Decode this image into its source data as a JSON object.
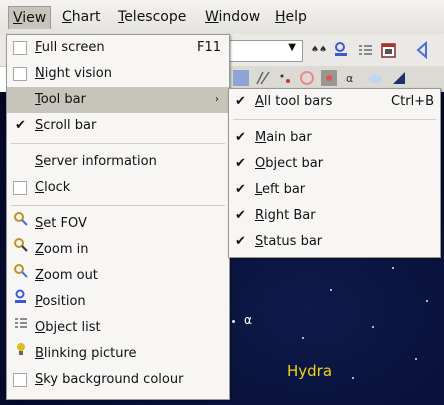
{
  "menubar": {
    "items": [
      {
        "label": "View",
        "u": "V",
        "rest": "iew"
      },
      {
        "label": "Chart",
        "u": "C",
        "rest": "hart"
      },
      {
        "label": "Telescope",
        "u": "T",
        "rest": "elescope"
      },
      {
        "label": "Window",
        "u": "W",
        "rest": "indow"
      },
      {
        "label": "Help",
        "u": "H",
        "rest": "elp"
      }
    ]
  },
  "view_menu": {
    "items": [
      {
        "pre": "",
        "u": "F",
        "rest": "ull screen",
        "shortcut": "F11"
      },
      {
        "pre": "",
        "u": "N",
        "rest": "ight vision"
      },
      {
        "pre": "",
        "u": "T",
        "rest": "ool bar",
        "arrow": "›"
      },
      {
        "pre": "",
        "u": "S",
        "rest": "croll bar"
      },
      {
        "pre": "",
        "u": "S",
        "rest": "erver information"
      },
      {
        "pre": "",
        "u": "C",
        "rest": "lock"
      },
      {
        "pre": "",
        "u": "S",
        "rest": "et FOV"
      },
      {
        "pre": "",
        "u": "Z",
        "rest": "oom in"
      },
      {
        "pre": "",
        "u": "Z",
        "rest": "oom out"
      },
      {
        "pre": "",
        "u": "P",
        "rest": "osition"
      },
      {
        "pre": "",
        "u": "O",
        "rest": "bject list"
      },
      {
        "pre": "",
        "u": "B",
        "rest": "linking picture"
      },
      {
        "pre": "",
        "u": "S",
        "rest": "ky background colour"
      }
    ]
  },
  "toolbar_submenu": {
    "items": [
      {
        "u": "A",
        "rest": "ll tool bars",
        "shortcut": "Ctrl+B",
        "checked": true
      },
      {
        "u": "M",
        "rest": "ain bar",
        "checked": true
      },
      {
        "u": "O",
        "rest": "bject bar",
        "checked": true
      },
      {
        "u": "L",
        "rest": "eft bar",
        "checked": true
      },
      {
        "u": "R",
        "rest": "ight Bar",
        "checked": true
      },
      {
        "u": "S",
        "rest": "tatus bar",
        "checked": true
      }
    ]
  },
  "sky": {
    "constellation_label": "Hydra",
    "star_label": "α"
  },
  "glyphs": {
    "tick": "✔",
    "combo_arrow": "▼",
    "binoculars": "♠♠"
  },
  "colors": {
    "highlight": "#c7c4bc",
    "sky": "#050b2e",
    "constellation": "#f2d21a"
  }
}
